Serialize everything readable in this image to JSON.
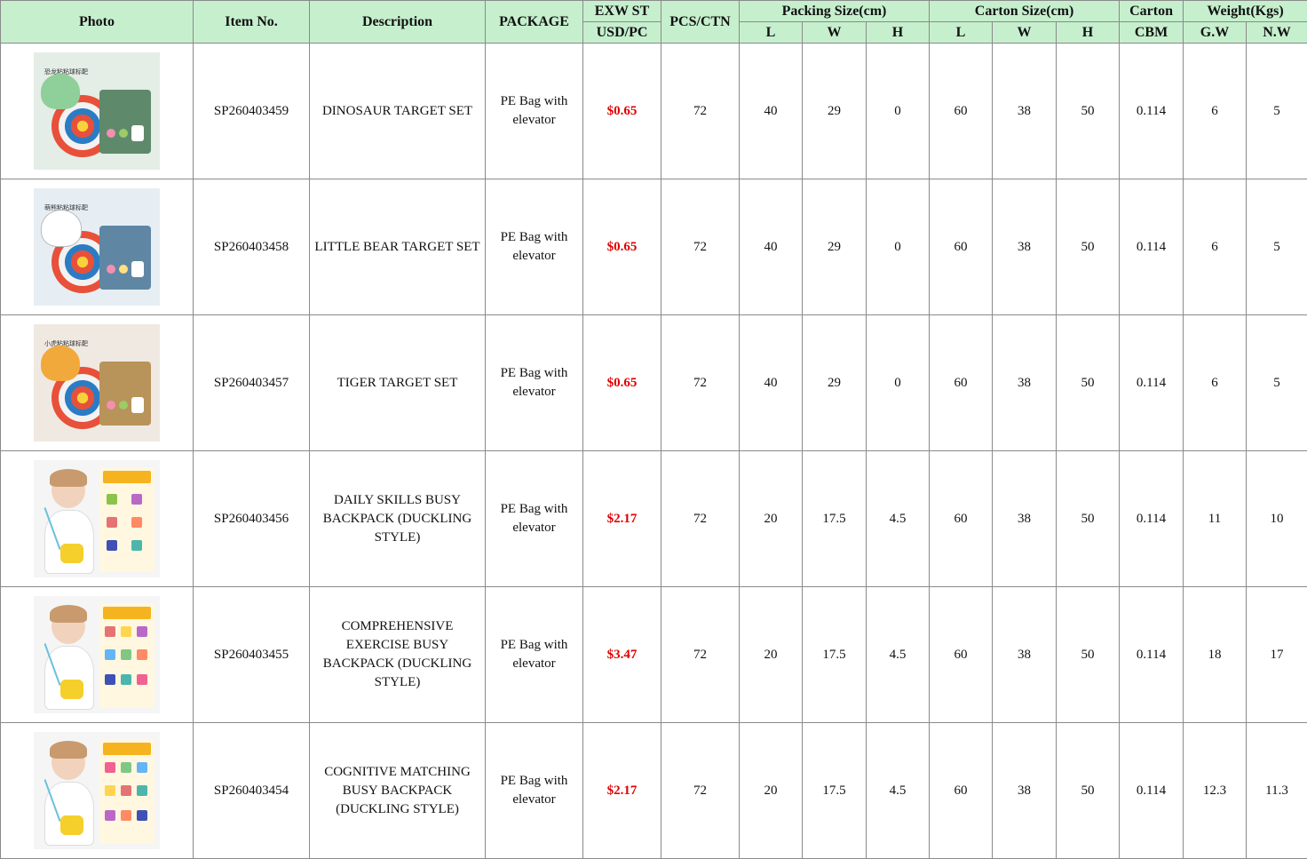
{
  "headers": {
    "photo": "Photo",
    "item_no": "Item No.",
    "description": "Description",
    "package": "PACKAGE",
    "exw_top": "EXW ST",
    "exw_bottom": "USD/PC",
    "pcs_ctn": "PCS/CTN",
    "packing_size": "Packing Size(cm)",
    "carton_size": "Carton Size(cm)",
    "carton_top": "Carton",
    "carton_bottom": "CBM",
    "weight": "Weight(Kgs)",
    "L": "L",
    "W": "W",
    "H": "H",
    "gw": "G.W",
    "nw": "N.W"
  },
  "rows": [
    {
      "photo_tag": "恐龙粘粘球标靶",
      "photo_icon": "dinosaur-target-photo",
      "item": "SP260403459",
      "description": "DINOSAUR TARGET SET",
      "package": "PE Bag with elevator",
      "price": "$0.65",
      "pcs": "72",
      "pack_l": "40",
      "pack_w": "29",
      "pack_h": "0",
      "ctn_l": "60",
      "ctn_w": "38",
      "ctn_h": "50",
      "cbm": "0.114",
      "gw": "6",
      "nw": "5"
    },
    {
      "photo_tag": "萌熊粘粘球标靶",
      "photo_icon": "bear-target-photo",
      "item": "SP260403458",
      "description": "LITTLE BEAR TARGET SET",
      "package": "PE Bag with elevator",
      "price": "$0.65",
      "pcs": "72",
      "pack_l": "40",
      "pack_w": "29",
      "pack_h": "0",
      "ctn_l": "60",
      "ctn_w": "38",
      "ctn_h": "50",
      "cbm": "0.114",
      "gw": "6",
      "nw": "5"
    },
    {
      "photo_tag": "小虎粘粘球标靶",
      "photo_icon": "tiger-target-photo",
      "item": "SP260403457",
      "description": "TIGER TARGET SET",
      "package": "PE Bag with elevator",
      "price": "$0.65",
      "pcs": "72",
      "pack_l": "40",
      "pack_w": "29",
      "pack_h": "0",
      "ctn_l": "60",
      "ctn_w": "38",
      "ctn_h": "50",
      "cbm": "0.114",
      "gw": "6",
      "nw": "5"
    },
    {
      "photo_icon": "busy-backpack-photo",
      "item": "SP260403456",
      "description": "DAILY SKILLS BUSY BACKPACK (DUCKLING STYLE)",
      "package": "PE Bag with elevator",
      "price": "$2.17",
      "pcs": "72",
      "pack_l": "20",
      "pack_w": "17.5",
      "pack_h": "4.5",
      "ctn_l": "60",
      "ctn_w": "38",
      "ctn_h": "50",
      "cbm": "0.114",
      "gw": "11",
      "nw": "10"
    },
    {
      "photo_icon": "busy-backpack-photo",
      "item": "SP260403455",
      "description": "COMPREHENSIVE EXERCISE BUSY BACKPACK (DUCKLING STYLE)",
      "package": "PE Bag with elevator",
      "price": "$3.47",
      "pcs": "72",
      "pack_l": "20",
      "pack_w": "17.5",
      "pack_h": "4.5",
      "ctn_l": "60",
      "ctn_w": "38",
      "ctn_h": "50",
      "cbm": "0.114",
      "gw": "18",
      "nw": "17"
    },
    {
      "photo_icon": "busy-backpack-photo",
      "item": "SP260403454",
      "description": "COGNITIVE MATCHING BUSY BACKPACK (DUCKLING STYLE)",
      "package": "PE Bag with elevator",
      "price": "$2.17",
      "pcs": "72",
      "pack_l": "20",
      "pack_w": "17.5",
      "pack_h": "4.5",
      "ctn_l": "60",
      "ctn_w": "38",
      "ctn_h": "50",
      "cbm": "0.114",
      "gw": "12.3",
      "nw": "11.3"
    }
  ]
}
